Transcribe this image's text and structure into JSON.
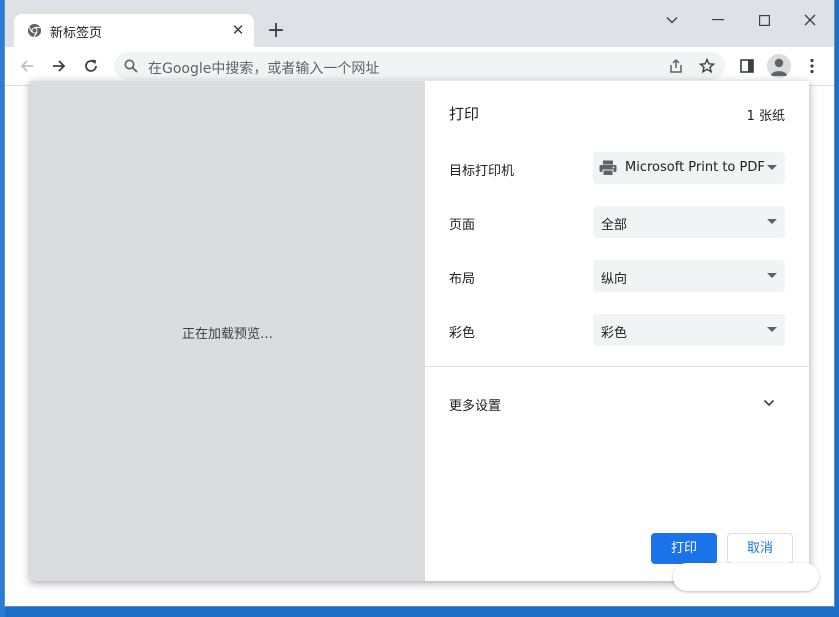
{
  "tab": {
    "title": "新标签页",
    "favicon": "chrome-icon"
  },
  "toolbar": {
    "omnibox_placeholder": "在Google中搜索，或者输入一个网址"
  },
  "print": {
    "title": "打印",
    "sheets": "1 张纸",
    "preview_loading": "正在加载预览…",
    "destination": {
      "label": "目标打印机",
      "value": "Microsoft Print to PDF"
    },
    "pages": {
      "label": "页面",
      "value": "全部"
    },
    "layout": {
      "label": "布局",
      "value": "纵向"
    },
    "color": {
      "label": "彩色",
      "value": "彩色"
    },
    "more_settings": "更多设置",
    "print_button": "打印",
    "cancel_button": "取消"
  },
  "colors": {
    "accent": "#1a73e8",
    "preview_bg": "#dadce0",
    "tabstrip_bg": "#dee1e6",
    "field_bg": "#f1f3f4"
  }
}
